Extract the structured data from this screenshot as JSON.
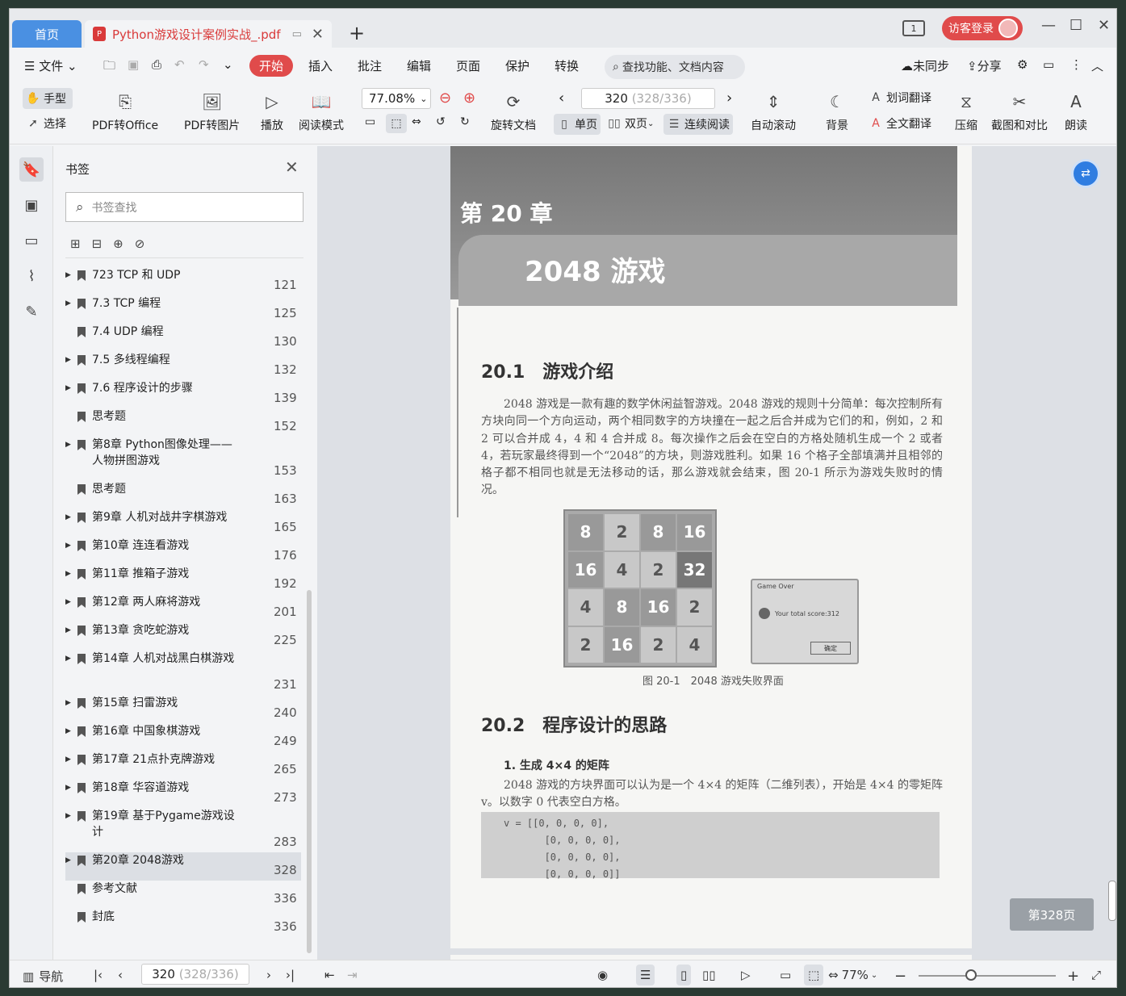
{
  "titlebar": {
    "home_tab": "首页",
    "doc_tab": "Python游戏设计案例实战_.pdf",
    "page_indicator": "1",
    "login_label": "访客登录"
  },
  "menu": {
    "file_label": "文件",
    "tabs": [
      "开始",
      "插入",
      "批注",
      "编辑",
      "页面",
      "保护",
      "转换"
    ],
    "search_label": "查找功能、文档内容",
    "sync_label": "未同步",
    "share_label": "分享"
  },
  "ribbon": {
    "hand_label": "手型",
    "select_label": "选择",
    "pdf_office": "PDF转Office",
    "pdf_image": "PDF转图片",
    "play": "播放",
    "read_mode": "阅读模式",
    "zoom_value": "77.08%",
    "rotate": "旋转文档",
    "page_value": "320",
    "page_total": "(328/336)",
    "single": "单页",
    "double": "双页",
    "continuous": "连续阅读",
    "auto_scroll": "自动滚动",
    "background": "背景",
    "word_translate": "划词翻译",
    "full_translate": "全文翻译",
    "compress": "压缩",
    "screenshot": "截图和对比",
    "read_aloud": "朗读"
  },
  "bookmarks": {
    "title": "书签",
    "search_placeholder": "书签查找",
    "items": [
      {
        "label": "723 TCP 和 UDP",
        "page": "121",
        "arrow": true
      },
      {
        "label": "7.3 TCP 编程",
        "page": "125",
        "arrow": true
      },
      {
        "label": "7.4 UDP 编程",
        "page": "130",
        "arrow": false
      },
      {
        "label": "7.5 多线程编程",
        "page": "132",
        "arrow": true
      },
      {
        "label": "7.6 程序设计的步骤",
        "page": "139",
        "arrow": true
      },
      {
        "label": "思考题",
        "page": "152",
        "arrow": false
      },
      {
        "label": "第8章 Python图像处理——人物拼图游戏",
        "page": "153",
        "arrow": true
      },
      {
        "label": "思考题",
        "page": "163",
        "arrow": false
      },
      {
        "label": "第9章 人机对战井字棋游戏",
        "page": "165",
        "arrow": true
      },
      {
        "label": "第10章 连连看游戏",
        "page": "176",
        "arrow": true
      },
      {
        "label": "第11章 推箱子游戏",
        "page": "192",
        "arrow": true
      },
      {
        "label": "第12章 两人麻将游戏",
        "page": "201",
        "arrow": true
      },
      {
        "label": "第13章 贪吃蛇游戏",
        "page": "225",
        "arrow": true
      },
      {
        "label": "第14章 人机对战黑白棋游戏",
        "page": "231",
        "arrow": true
      },
      {
        "label": "第15章 扫雷游戏",
        "page": "240",
        "arrow": true
      },
      {
        "label": "第16章 中国象棋游戏",
        "page": "249",
        "arrow": true
      },
      {
        "label": "第17章 21点扑克牌游戏",
        "page": "265",
        "arrow": true
      },
      {
        "label": "第18章 华容道游戏",
        "page": "273",
        "arrow": true
      },
      {
        "label": "第19章 基于Pygame游戏设计",
        "page": "283",
        "arrow": true
      },
      {
        "label": "第20章 2048游戏",
        "page": "328",
        "arrow": true,
        "selected": true
      },
      {
        "label": "参考文献",
        "page": "336",
        "arrow": false
      },
      {
        "label": "封底",
        "page": "336",
        "arrow": false
      }
    ]
  },
  "document": {
    "chapter": "第 20 章",
    "chapter_title": "2048 游戏",
    "s1_title": "20.1　游戏介绍",
    "s1_text": "2048 游戏是一款有趣的数学休闲益智游戏。2048 游戏的规则十分简单：每次控制所有方块向同一个方向运动，两个相同数字的方块撞在一起之后合并成为它们的和，例如，2 和 2 可以合并成 4，4 和 4 合并成 8。每次操作之后会在空白的方格处随机生成一个 2 或者 4，若玩家最终得到一个“2048”的方块，则游戏胜利。如果 16 个格子全部填满并且相邻的格子都不相同也就是无法移动的话，那么游戏就会结束，图 20-1 所示为游戏失败时的情况。",
    "grid": [
      "8",
      "2",
      "8",
      "16",
      "16",
      "4",
      "2",
      "32",
      "4",
      "8",
      "16",
      "2",
      "2",
      "16",
      "2",
      "4"
    ],
    "dialog_title": "Game Over",
    "dialog_msg": "Your total score:312",
    "dialog_ok": "确定",
    "caption": "图 20-1　2048 游戏失败界面",
    "s2_title": "20.2　程序设计的思路",
    "s2_sub": "1. 生成 4×4 的矩阵",
    "s2_text": "2048 游戏的方块界面可以认为是一个 4×4 的矩阵（二维列表），开始是 4×4 的零矩阵 v。以数字 0 代表空白方格。",
    "code": "v = [[0, 0, 0, 0],\n       [0, 0, 0, 0],\n       [0, 0, 0, 0],\n       [0, 0, 0, 0]]",
    "page_badge": "第328页"
  },
  "statusbar": {
    "nav_label": "导航",
    "page_value": "320",
    "page_total": "(328/336)",
    "zoom": "77%"
  }
}
